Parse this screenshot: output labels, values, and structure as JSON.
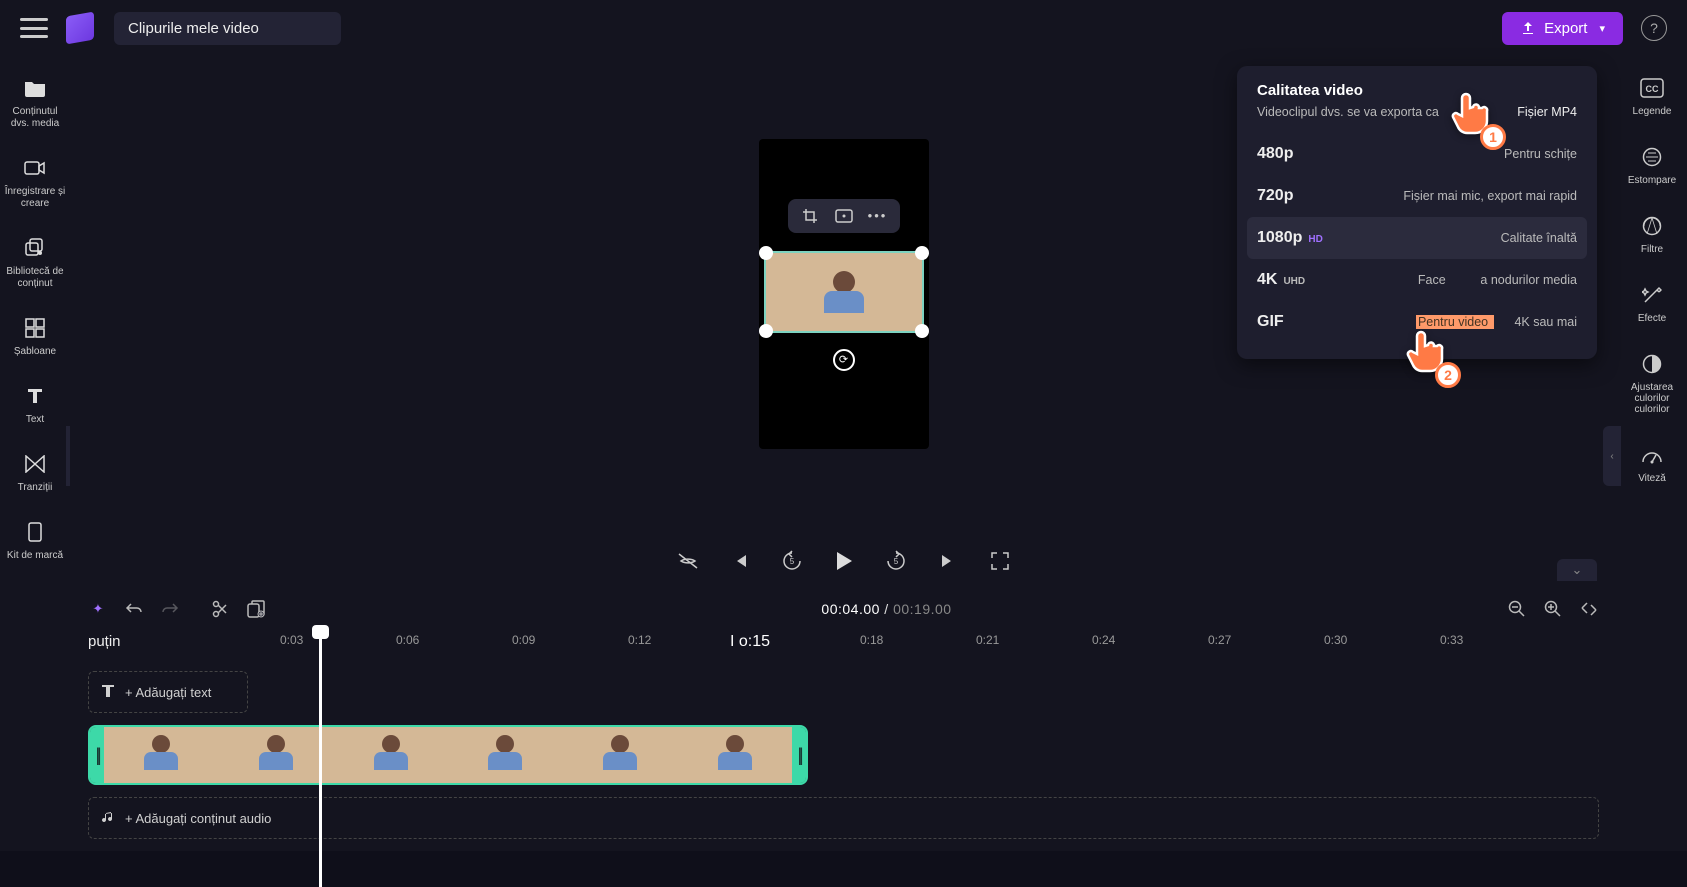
{
  "project_title": "Clipurile mele video",
  "export_button_label": "Export",
  "left_sidebar": [
    {
      "key": "media",
      "label": "Conținutul dvs. media"
    },
    {
      "key": "record",
      "label": "Înregistrare și creare"
    },
    {
      "key": "library",
      "label": "Bibliotecă de conținut"
    },
    {
      "key": "templates",
      "label": "Șabloane"
    },
    {
      "key": "text",
      "label": "Text"
    },
    {
      "key": "transitions",
      "label": "Tranziții"
    },
    {
      "key": "brand",
      "label": "Kit de marcă"
    }
  ],
  "right_sidebar": [
    {
      "key": "captions",
      "label": "Legende"
    },
    {
      "key": "fade",
      "label": "Estompare"
    },
    {
      "key": "filters",
      "label": "Filtre"
    },
    {
      "key": "effects",
      "label": "Efecte"
    },
    {
      "key": "adjust",
      "label": "Ajustarea culorilor culorilor"
    },
    {
      "key": "speed",
      "label": "Viteză"
    }
  ],
  "export_panel": {
    "title": "Calitatea video",
    "subtitle": "Videoclipul dvs. se va exporta ca",
    "file_format": "Fișier MP4",
    "options": [
      {
        "label": "480p",
        "badge": "",
        "desc": "Pentru schițe"
      },
      {
        "label": "720p",
        "badge": "",
        "desc": "Fișier mai mic, export mai rapid"
      },
      {
        "label": "1080p",
        "badge": "HD",
        "desc": "Calitate înaltă"
      },
      {
        "label": "4K",
        "badge": "UHD",
        "desc_pre": "Face ",
        "desc_post": " a nodurilor media"
      },
      {
        "label": "GIF",
        "badge": "",
        "desc_highlight": "Pentru video ",
        "desc_post2": " 4K sau mai"
      }
    ]
  },
  "playback": {
    "current": "00:04.00",
    "duration": "00:19.00"
  },
  "ruler": {
    "zoom_label": "puțin",
    "ticks": [
      "0:03",
      "0:06",
      "0:09",
      "0:12",
      "0:18",
      "0:21",
      "0:24",
      "0:27",
      "0:30",
      "0:33"
    ],
    "marker": "I o:15"
  },
  "tracks": {
    "text_placeholder": "+  Adăugați text",
    "audio_placeholder": "+  Adăugați conținut audio"
  },
  "overlay_badges": {
    "one": "1",
    "two": "2"
  }
}
